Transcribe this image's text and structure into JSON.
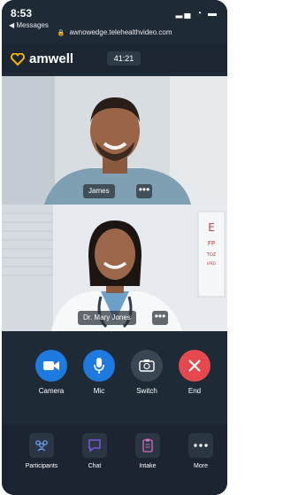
{
  "status": {
    "time": "8:53",
    "back_app": "◀ Messages",
    "url": "awnowedge.telehealthvideo.com",
    "icons": "▂▄ ◔ ▬"
  },
  "topbar": {
    "logo_text": "amwell",
    "timer": "41:21"
  },
  "participants": [
    {
      "name": "James",
      "more": "•••"
    },
    {
      "name": "Dr. Mary Jones",
      "more": "•••"
    }
  ],
  "controls": [
    {
      "label": "Camera",
      "icon": "camera-icon",
      "color": "#1f7ae0"
    },
    {
      "label": "Mic",
      "icon": "microphone-icon",
      "color": "#1f7ae0"
    },
    {
      "label": "Switch",
      "icon": "switch-camera-icon",
      "color": "#394654"
    },
    {
      "label": "End",
      "icon": "close-icon",
      "color": "#e5484d"
    }
  ],
  "nav": [
    {
      "label": "Participants",
      "icon": "participants-icon"
    },
    {
      "label": "Chat",
      "icon": "chat-icon"
    },
    {
      "label": "Intake",
      "icon": "clipboard-icon"
    },
    {
      "label": "More",
      "icon": "more-icon"
    }
  ],
  "colors": {
    "background": "#1f2a37",
    "accent_blue": "#1f7ae0",
    "end_red": "#e5484d",
    "nav_icon_purple": "#8b5cf6",
    "logo_yellow": "#f4b400"
  }
}
